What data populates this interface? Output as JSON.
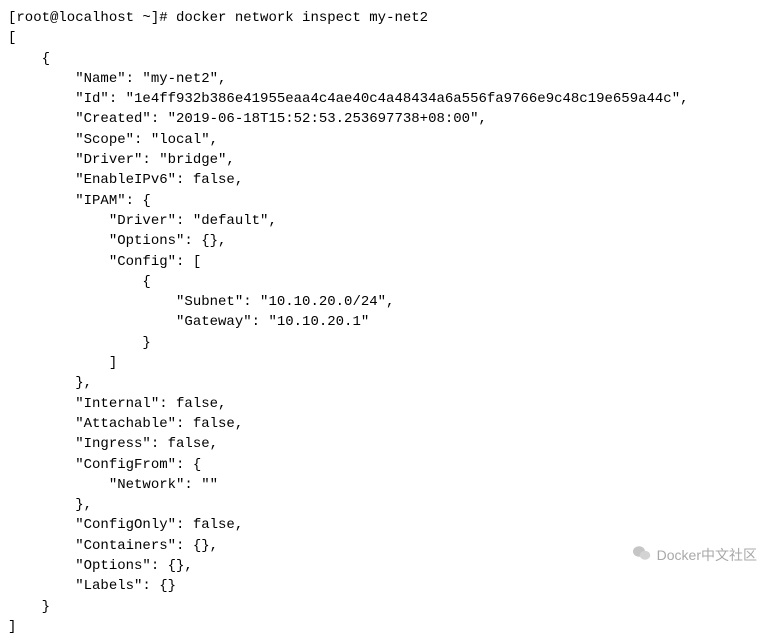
{
  "prompt": "[root@localhost ~]# ",
  "command": "docker network inspect my-net2",
  "output": {
    "open_bracket": "[",
    "open_brace": "    {",
    "name_line": "        \"Name\": \"my-net2\",",
    "id_line": "        \"Id\": \"1e4ff932b386e41955eaa4c4ae40c4a48434a6a556fa9766e9c48c19e659a44c\",",
    "created_line": "        \"Created\": \"2019-06-18T15:52:53.253697738+08:00\",",
    "scope_line": "        \"Scope\": \"local\",",
    "driver_line": "        \"Driver\": \"bridge\",",
    "enableipv6_line": "        \"EnableIPv6\": false,",
    "ipam_open": "        \"IPAM\": {",
    "ipam_driver": "            \"Driver\": \"default\",",
    "ipam_options": "            \"Options\": {},",
    "ipam_config_open": "            \"Config\": [",
    "ipam_config_brace_open": "                {",
    "ipam_subnet": "                    \"Subnet\": \"10.10.20.0/24\",",
    "ipam_gateway": "                    \"Gateway\": \"10.10.20.1\"",
    "ipam_config_brace_close": "                }",
    "ipam_config_close": "            ]",
    "ipam_close": "        },",
    "internal_line": "        \"Internal\": false,",
    "attachable_line": "        \"Attachable\": false,",
    "ingress_line": "        \"Ingress\": false,",
    "configfrom_open": "        \"ConfigFrom\": {",
    "configfrom_network": "            \"Network\": \"\"",
    "configfrom_close": "        },",
    "configonly_line": "        \"ConfigOnly\": false,",
    "containers_line": "        \"Containers\": {},",
    "options_line": "        \"Options\": {},",
    "labels_line": "        \"Labels\": {}",
    "close_brace": "    }",
    "close_bracket": "]"
  },
  "watermark": {
    "text": "Docker中文社区"
  },
  "network_data": {
    "Name": "my-net2",
    "Id": "1e4ff932b386e41955eaa4c4ae40c4a48434a6a556fa9766e9c48c19e659a44c",
    "Created": "2019-06-18T15:52:53.253697738+08:00",
    "Scope": "local",
    "Driver": "bridge",
    "EnableIPv6": false,
    "IPAM": {
      "Driver": "default",
      "Options": {},
      "Config": [
        {
          "Subnet": "10.10.20.0/24",
          "Gateway": "10.10.20.1"
        }
      ]
    },
    "Internal": false,
    "Attachable": false,
    "Ingress": false,
    "ConfigFrom": {
      "Network": ""
    },
    "ConfigOnly": false,
    "Containers": {},
    "Options": {},
    "Labels": {}
  }
}
